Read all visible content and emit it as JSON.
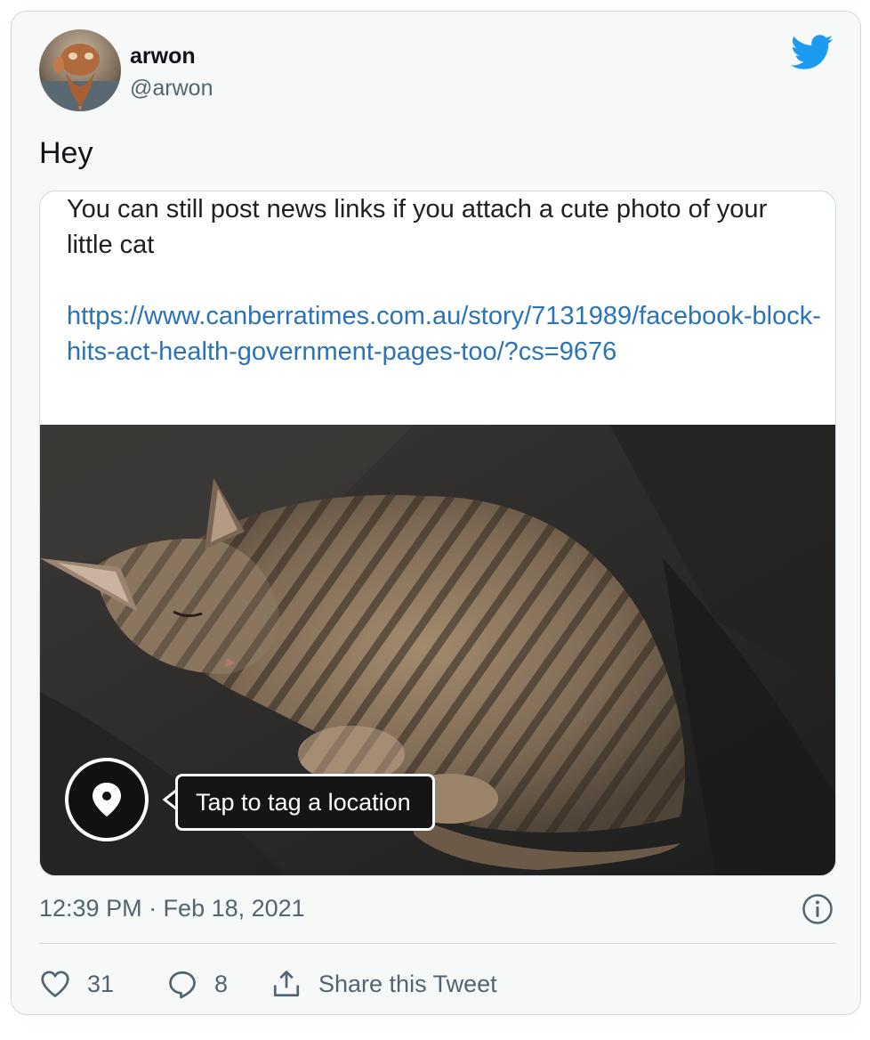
{
  "tweet": {
    "display_name": "arwon",
    "handle": "@arwon",
    "text": "Hey",
    "timestamp": "12:39 PM · Feb 18, 2021"
  },
  "embedded_screenshot": {
    "text": "You can still post news links if you attach a cute photo of your little cat",
    "link": "https://www.canberratimes.com.au/story/7131989/facebook-block-hits-act-health-government-pages-too/?cs=9676",
    "tooltip": "Tap to tag a location"
  },
  "actions": {
    "likes": "31",
    "replies": "8",
    "share_label": "Share this Tweet"
  },
  "colors": {
    "twitter_blue": "#1d9bf0",
    "link_blue": "#2a73b9",
    "card_bg": "#f7f9f9",
    "secondary_text": "#536471"
  },
  "icons": [
    "twitter-bird-icon",
    "info-icon",
    "heart-icon",
    "reply-icon",
    "share-icon",
    "location-pin-icon"
  ]
}
